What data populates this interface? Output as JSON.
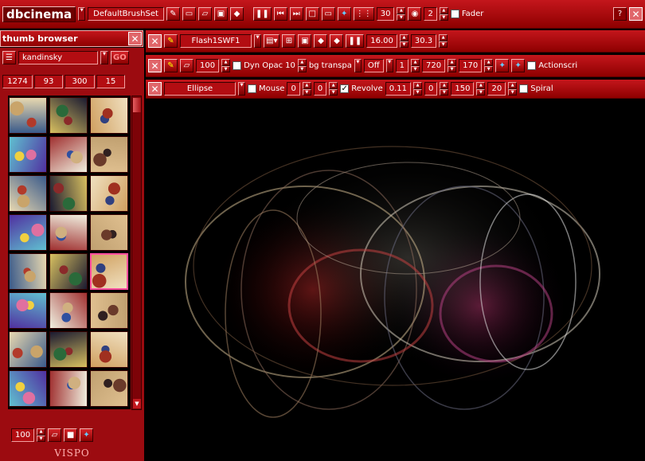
{
  "app": {
    "name": "dbcinema",
    "brushset": "DefaultBrushSet"
  },
  "topbar": {
    "frames_value": "30",
    "view_value": "2",
    "fader_label": "Fader",
    "help_label": "?"
  },
  "brush_row": {
    "brush_name": "Flash1SWF1",
    "speed_value": "16.00",
    "fps_value": "30.3"
  },
  "params_row": {
    "size_value": "100",
    "dyn_opac_label": "Dyn Opac",
    "opac_value": "10",
    "bg_mode": "bg transpa",
    "blend_mode": "Off",
    "step_value": "1",
    "width_value": "720",
    "height_value": "170",
    "actionscript_label": "Actionscri"
  },
  "shape_row": {
    "shape": "Ellipse",
    "mouse_label": "Mouse",
    "x_value": "0",
    "y_value": "0",
    "revolve_label": "Revolve",
    "revolve_value": "0.11",
    "start_value": "0",
    "radius_value": "150",
    "steps_value": "20",
    "spiral_label": "Spiral"
  },
  "browser": {
    "title": "thumb browser",
    "collection": "kandinsky",
    "go_label": "GO",
    "stats": [
      "1274",
      "93",
      "300",
      "15"
    ],
    "selected_index": 14,
    "bottom_size_value": "100",
    "footer_logo": "VISPO"
  },
  "colors": {
    "toolbar_red": "#c4161c",
    "toolbar_dark": "#8e0000",
    "selection_border": "#ff4fa0",
    "canvas_bg": "#000000"
  }
}
